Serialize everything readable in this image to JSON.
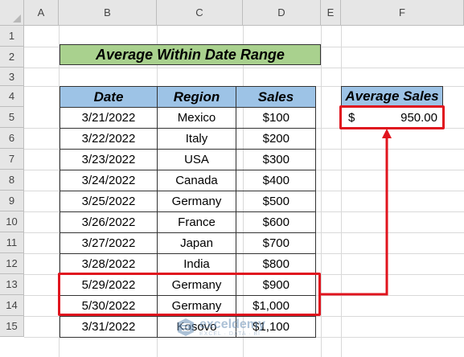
{
  "columns": [
    "A",
    "B",
    "C",
    "D",
    "E",
    "F"
  ],
  "rows": [
    "1",
    "2",
    "3",
    "4",
    "5",
    "6",
    "7",
    "8",
    "9",
    "10",
    "11",
    "12",
    "13",
    "14",
    "15"
  ],
  "title": "Average Within Date Range",
  "table": {
    "headers": {
      "date": "Date",
      "region": "Region",
      "sales": "Sales"
    },
    "rows": [
      {
        "date": "3/21/2022",
        "region": "Mexico",
        "sales": "$100"
      },
      {
        "date": "3/22/2022",
        "region": "Italy",
        "sales": "$200"
      },
      {
        "date": "3/23/2022",
        "region": "USA",
        "sales": "$300"
      },
      {
        "date": "3/24/2022",
        "region": "Canada",
        "sales": "$400"
      },
      {
        "date": "3/25/2022",
        "region": "Germany",
        "sales": "$500"
      },
      {
        "date": "3/26/2022",
        "region": "France",
        "sales": "$600"
      },
      {
        "date": "3/27/2022",
        "region": "Japan",
        "sales": "$700"
      },
      {
        "date": "3/28/2022",
        "region": "India",
        "sales": "$800"
      },
      {
        "date": "5/29/2022",
        "region": "Germany",
        "sales": "$900"
      },
      {
        "date": "5/30/2022",
        "region": "Germany",
        "sales": "$1,000"
      },
      {
        "date": "3/31/2022",
        "region": "Kosovo",
        "sales": "$1,100"
      }
    ]
  },
  "average": {
    "header": "Average Sales",
    "currency": "$",
    "value": "950.00"
  },
  "watermark": {
    "name": "exceldemy",
    "tagline": "EXCEL · DATA · BI"
  },
  "colors": {
    "title_bg": "#a9d18e",
    "header_bg": "#9dc3e6",
    "highlight": "#e0141e"
  }
}
